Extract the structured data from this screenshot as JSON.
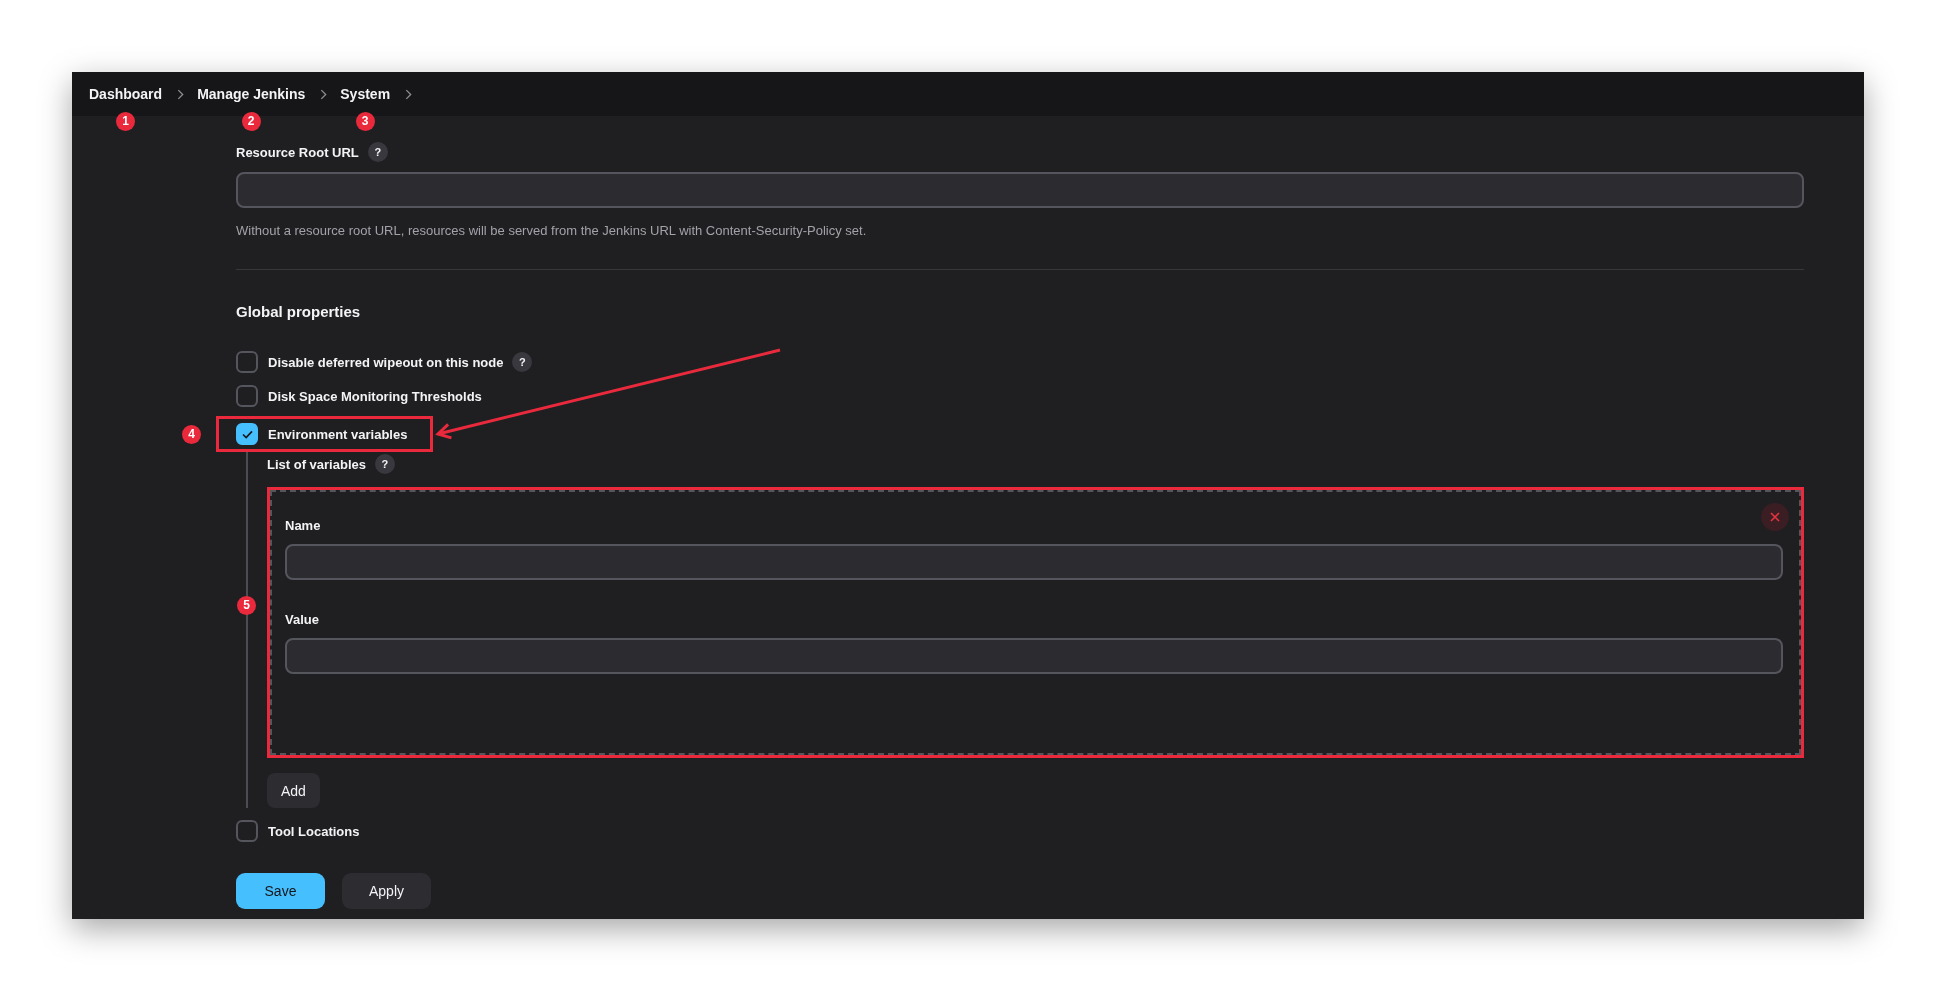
{
  "breadcrumbs": [
    {
      "label": "Dashboard",
      "callout": "1"
    },
    {
      "label": "Manage Jenkins",
      "callout": "2"
    },
    {
      "label": "System",
      "callout": "3"
    }
  ],
  "resource_root_url": {
    "label": "Resource Root URL",
    "help": "?",
    "description": "Without a resource root URL, resources will be served from the Jenkins URL with Content-Security-Policy set."
  },
  "global_properties": {
    "heading": "Global properties",
    "options": [
      {
        "label": "Disable deferred wipeout on this node",
        "checked": false,
        "help": "?"
      },
      {
        "label": "Disk Space Monitoring Thresholds",
        "checked": false
      },
      {
        "label": "Environment variables",
        "checked": true,
        "callout": "4",
        "outlined": true,
        "arrow": true,
        "variables": {
          "label": "List of variables",
          "help": "?",
          "entries": [
            {
              "callout": "5",
              "outlined": true,
              "fields": [
                {
                  "label": "Name"
                },
                {
                  "label": "Value"
                }
              ]
            }
          ],
          "add_button": "Add"
        }
      },
      {
        "label": "Tool Locations",
        "checked": false
      }
    ]
  },
  "buttons": [
    {
      "label": "Save",
      "kind": "primary"
    },
    {
      "label": "Apply",
      "kind": "secondary"
    }
  ]
}
